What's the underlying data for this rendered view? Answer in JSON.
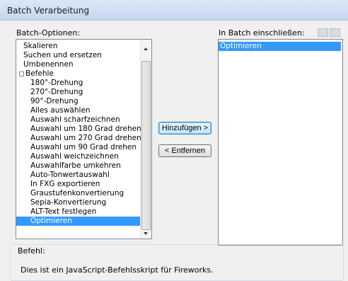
{
  "window": {
    "title": "Batch Verarbeitung"
  },
  "left": {
    "label": "Batch-Optionen:",
    "items": [
      {
        "label": "Skalieren"
      },
      {
        "label": "Suchen und ersetzen"
      },
      {
        "label": "Umbenennen"
      },
      {
        "label": "Befehle",
        "expander": "⊟"
      },
      {
        "label": "180°-Drehung"
      },
      {
        "label": "270°-Drehung"
      },
      {
        "label": "90°-Drehung"
      },
      {
        "label": "Alles auswählen"
      },
      {
        "label": "Auswahl scharfzeichnen"
      },
      {
        "label": "Auswahl um 180 Grad drehen"
      },
      {
        "label": "Auswahl um 270 Grad drehen"
      },
      {
        "label": "Auswahl um 90 Grad drehen"
      },
      {
        "label": "Auswahl weichzeichnen"
      },
      {
        "label": "Auswahlfarbe umkehren"
      },
      {
        "label": "Auto-Tonwertauswahl"
      },
      {
        "label": "In FXG exportieren"
      },
      {
        "label": "Graustufenkonvertierung"
      },
      {
        "label": "Sepia-Konvertierung"
      },
      {
        "label": "ALT-Text festlegen"
      },
      {
        "label": "Optimieren",
        "selected": true
      }
    ]
  },
  "buttons": {
    "add": "Hinzufügen >",
    "remove": "< Entfernen"
  },
  "right": {
    "label": "In Batch einschließen:",
    "items": [
      {
        "label": "Optimieren",
        "selected": true
      }
    ]
  },
  "command": {
    "label": "Befehl:",
    "description": "Dies ist ein JavaScript-Befehlsskript für Fireworks."
  }
}
